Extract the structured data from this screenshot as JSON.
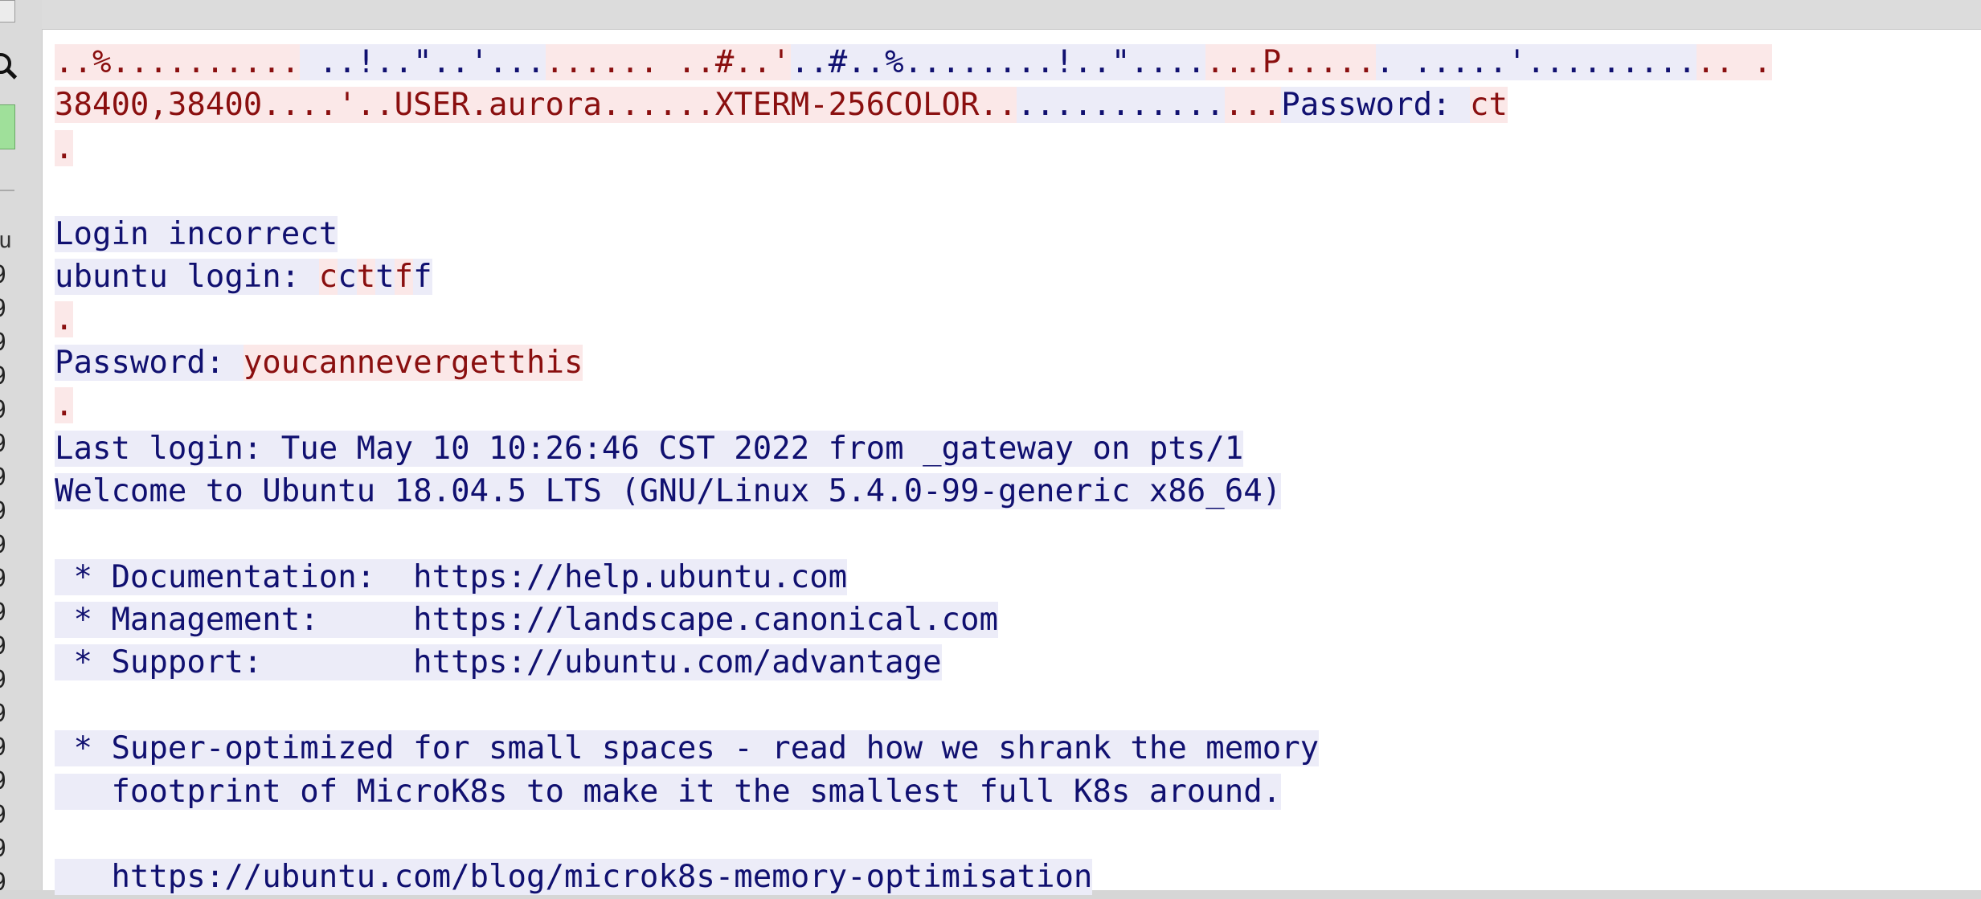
{
  "window": {
    "title": "",
    "gutter_header": "u",
    "gutter_numbers": [
      "9",
      "9",
      "9",
      "9",
      "9",
      "9",
      "9",
      "9",
      "9",
      "9",
      "9",
      "9",
      "9",
      "9",
      "9",
      "9",
      "9",
      "9",
      "9"
    ]
  },
  "stream_legend": {
    "client_color": "#8a0f0f",
    "client_bg": "#fbe8e8",
    "server_color": "#101070",
    "server_bg": "#ececf8"
  },
  "stream": [
    [
      {
        "d": "c",
        "t": "..%.........."
      },
      {
        "d": "s",
        "t": " ..!..\"..'..."
      },
      {
        "d": "c",
        "t": "...... ..#..'"
      },
      {
        "d": "s",
        "t": "..#..%........!..\"...."
      },
      {
        "d": "c",
        "t": "...P....."
      },
      {
        "d": "s",
        "t": ". .....'........."
      },
      {
        "d": "c",
        "t": ".. ."
      }
    ],
    [
      {
        "d": "c",
        "t": "38400,38400....'..USER.aurora......XTERM-256COLOR.."
      },
      {
        "d": "s",
        "t": "..........."
      },
      {
        "d": "c",
        "t": "..."
      },
      {
        "d": "s",
        "t": "Password: "
      },
      {
        "d": "c",
        "t": "ct"
      }
    ],
    [
      {
        "d": "c",
        "t": "."
      }
    ],
    [],
    [
      {
        "d": "s",
        "t": "Login incorrect"
      }
    ],
    [
      {
        "d": "s",
        "t": "ubuntu login: "
      },
      {
        "d": "c",
        "t": "c"
      },
      {
        "d": "s",
        "t": "c"
      },
      {
        "d": "c",
        "t": "t"
      },
      {
        "d": "s",
        "t": "t"
      },
      {
        "d": "c",
        "t": "f"
      },
      {
        "d": "s",
        "t": "f"
      }
    ],
    [
      {
        "d": "c",
        "t": "."
      }
    ],
    [
      {
        "d": "s",
        "t": "Password: "
      },
      {
        "d": "c",
        "t": "youcannevergetthis"
      }
    ],
    [
      {
        "d": "c",
        "t": "."
      }
    ],
    [
      {
        "d": "s",
        "t": "Last login: Tue May 10 10:26:46 CST 2022 from _gateway on pts/1"
      }
    ],
    [
      {
        "d": "s",
        "t": "Welcome to Ubuntu 18.04.5 LTS (GNU/Linux 5.4.0-99-generic x86_64)"
      }
    ],
    [],
    [
      {
        "d": "s",
        "t": " * Documentation:  https://help.ubuntu.com"
      }
    ],
    [
      {
        "d": "s",
        "t": " * Management:     https://landscape.canonical.com"
      }
    ],
    [
      {
        "d": "s",
        "t": " * Support:        https://ubuntu.com/advantage"
      }
    ],
    [],
    [
      {
        "d": "s",
        "t": " * Super-optimized for small spaces - read how we shrank the memory"
      }
    ],
    [
      {
        "d": "s",
        "t": "   footprint of MicroK8s to make it the smallest full K8s around."
      }
    ],
    [],
    [
      {
        "d": "s",
        "t": "   https://ubuntu.com/blog/microk8s-memory-optimisation"
      }
    ]
  ]
}
